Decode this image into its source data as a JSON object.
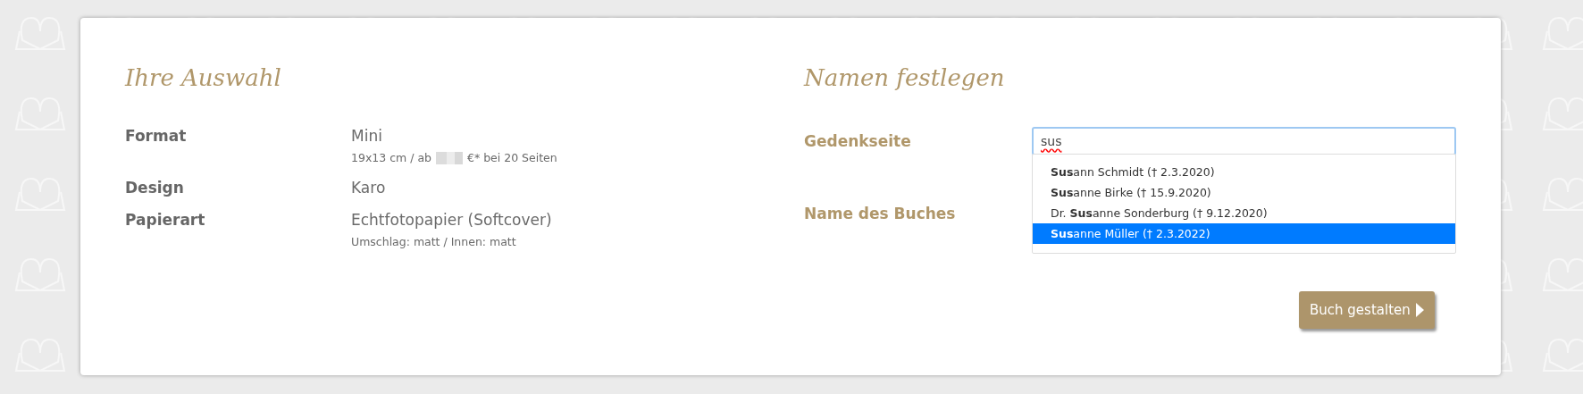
{
  "selection": {
    "title": "Ihre Auswahl",
    "rows": [
      {
        "label": "Format",
        "value": "Mini",
        "note_before": "19x13 cm / ab",
        "note_after": "€* bei 20 Seiten",
        "price_hidden": true
      },
      {
        "label": "Design",
        "value": "Karo"
      },
      {
        "label": "Papierart",
        "value": "Echtfotopapier (Softcover)",
        "note_before": "Umschlag: matt / Innen: matt"
      }
    ]
  },
  "names": {
    "title": "Namen festlegen",
    "memorial_label": "Gedenkseite",
    "memorial_value": "sus",
    "book_name_label": "Name des Buches",
    "suggestions": [
      {
        "text": "**Sus**ann Schmidt († 2.3.2020)",
        "selected": false
      },
      {
        "text": "**Sus**anne Birke († 15.9.2020)",
        "selected": false
      },
      {
        "text": "Dr. **Sus**anne Sonderburg († 9.12.2020)",
        "selected": false
      },
      {
        "text": "**Sus**anne Müller († 2.3.2022)",
        "selected": true
      }
    ]
  },
  "button": {
    "label": "Buch gestalten"
  }
}
